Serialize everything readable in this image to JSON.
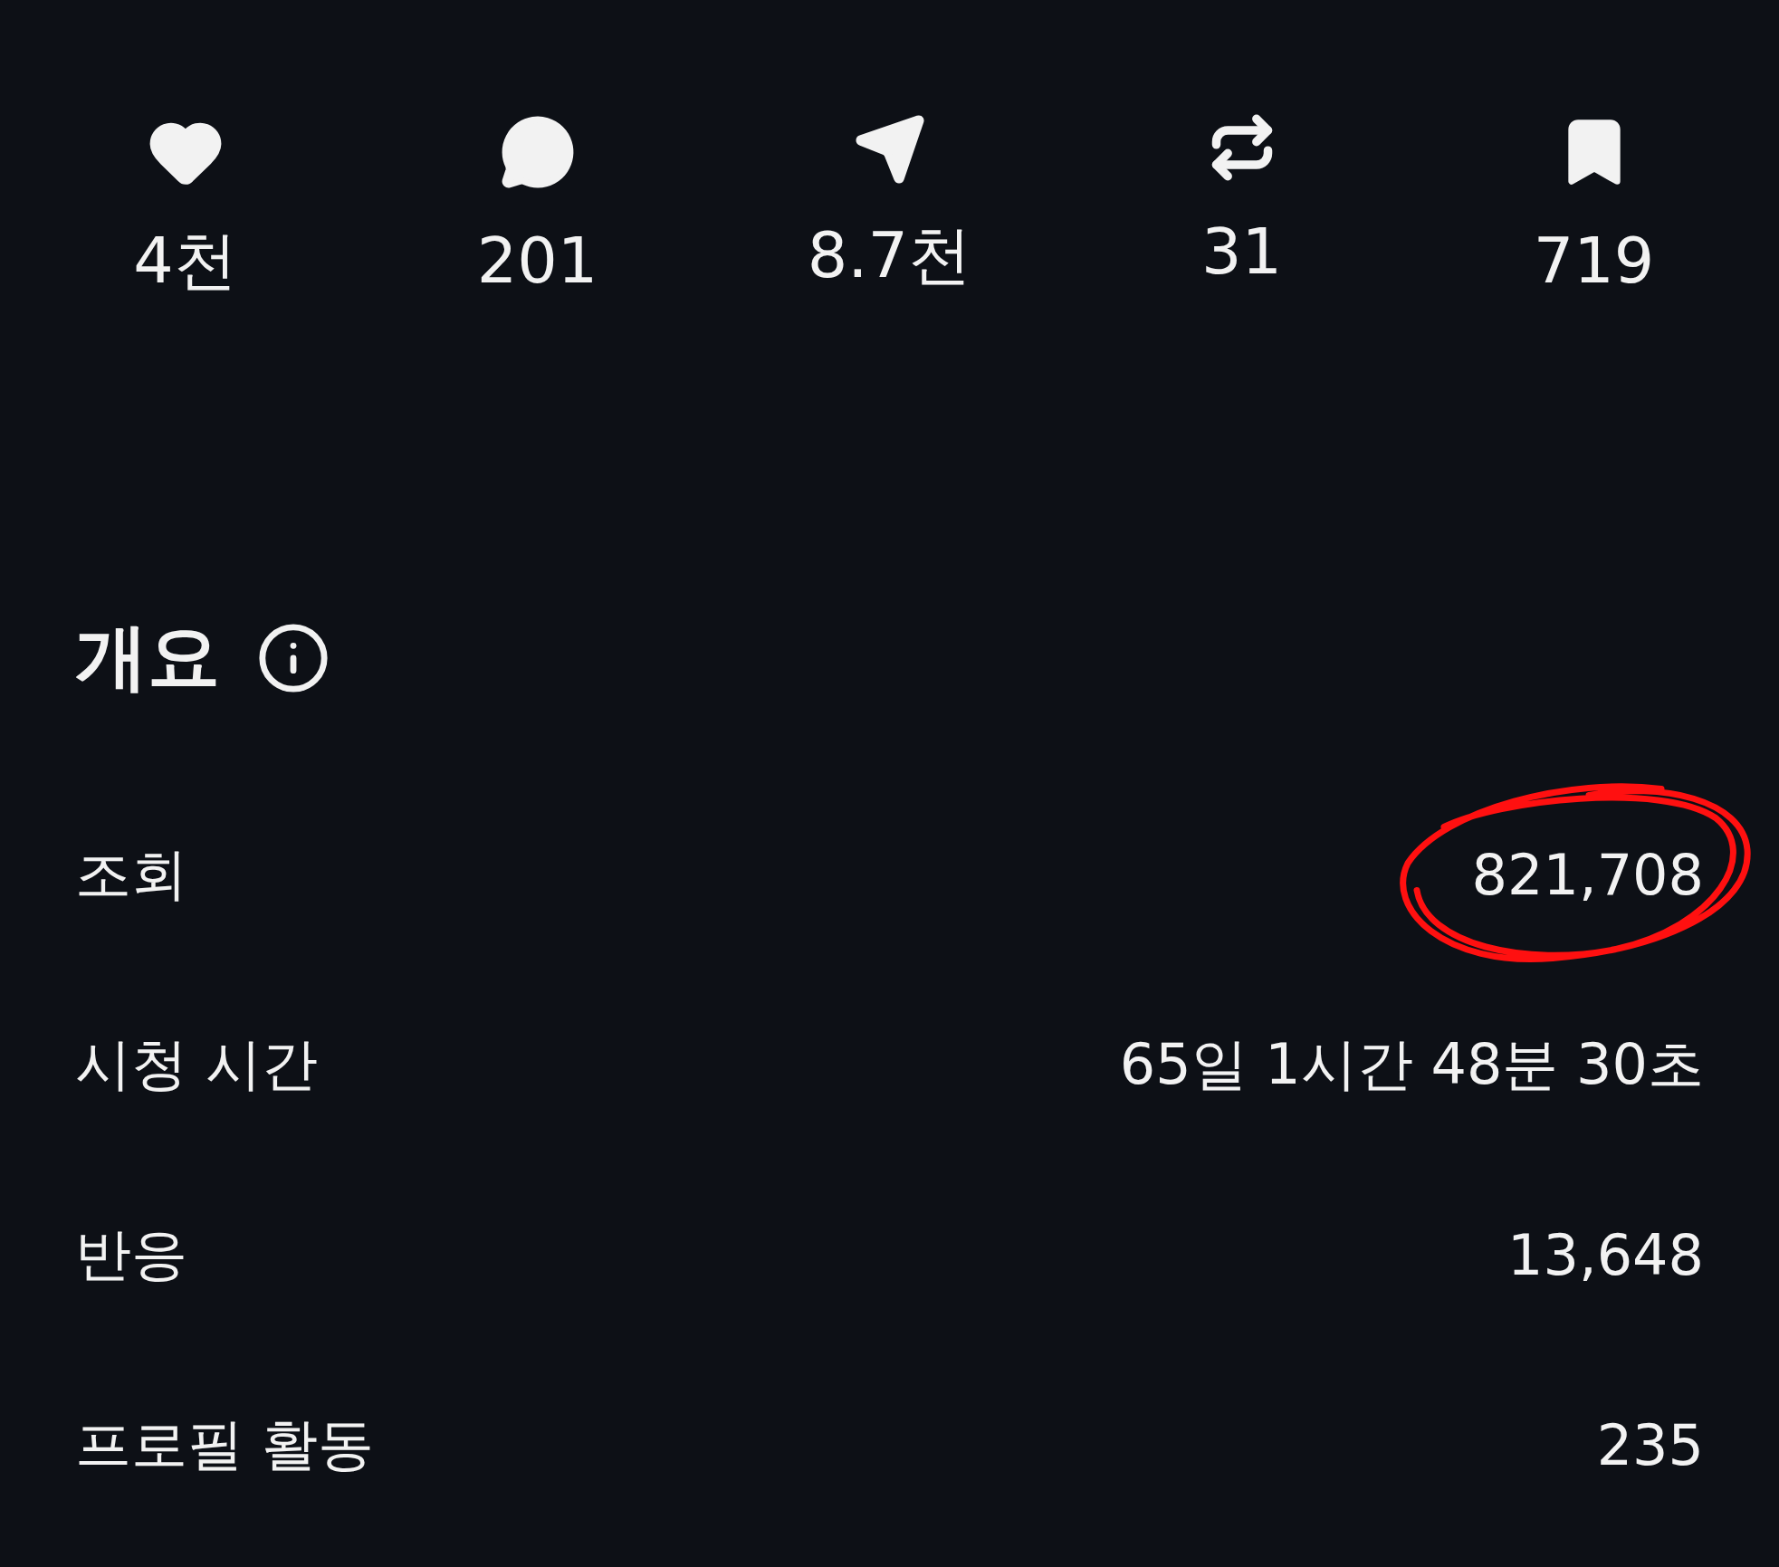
{
  "stats": [
    {
      "kind": "like",
      "value": "4천"
    },
    {
      "kind": "comment",
      "value": "201"
    },
    {
      "kind": "share",
      "value": "8.7천"
    },
    {
      "kind": "repost",
      "value": "31"
    },
    {
      "kind": "save",
      "value": "719"
    }
  ],
  "overview": {
    "title": "개요",
    "rows": [
      {
        "label": "조회",
        "value": "821,708",
        "highlighted": true
      },
      {
        "label": "시청 시간",
        "value": "65일 1시간 48분 30초",
        "highlighted": false
      },
      {
        "label": "반응",
        "value": "13,648",
        "highlighted": false
      },
      {
        "label": "프로필 활동",
        "value": "235",
        "highlighted": false
      }
    ]
  }
}
